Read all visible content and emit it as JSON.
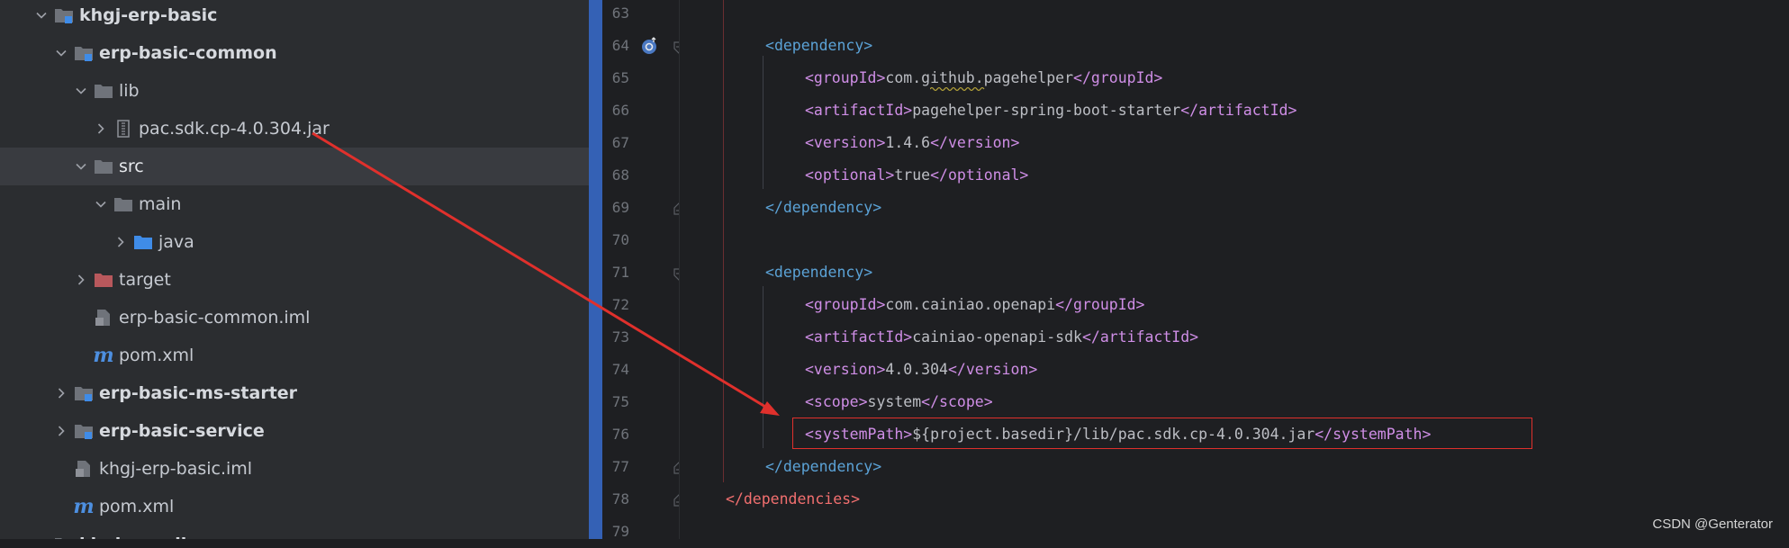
{
  "tree": {
    "items": [
      {
        "label": "khgj-erp-basic",
        "icon": "module-folder-icon",
        "bold": true
      },
      {
        "label": "erp-basic-common",
        "icon": "module-folder-icon",
        "bold": true
      },
      {
        "label": "lib",
        "icon": "folder-icon",
        "bold": false
      },
      {
        "label": "pac.sdk.cp-4.0.304.jar",
        "icon": "jar-icon",
        "bold": false
      },
      {
        "label": "src",
        "icon": "folder-icon",
        "bold": false
      },
      {
        "label": "main",
        "icon": "folder-icon",
        "bold": false
      },
      {
        "label": "java",
        "icon": "source-folder-icon",
        "bold": false
      },
      {
        "label": "target",
        "icon": "excluded-folder-icon",
        "bold": false
      },
      {
        "label": "erp-basic-common.iml",
        "icon": "iml-file-icon",
        "bold": false
      },
      {
        "label": "pom.xml",
        "icon": "maven-icon",
        "bold": false
      },
      {
        "label": "erp-basic-ms-starter",
        "icon": "module-folder-icon",
        "bold": true
      },
      {
        "label": "erp-basic-service",
        "icon": "module-folder-icon",
        "bold": true
      },
      {
        "label": "khgj-erp-basic.iml",
        "icon": "iml-file-icon",
        "bold": false
      },
      {
        "label": "pom.xml",
        "icon": "maven-icon",
        "bold": false
      },
      {
        "label": "khgj-supplier",
        "icon": "module-folder-icon",
        "bold": true
      }
    ],
    "selected": "src"
  },
  "editor": {
    "line_numbers": [
      "63",
      "64",
      "65",
      "66",
      "67",
      "68",
      "69",
      "70",
      "71",
      "72",
      "73",
      "74",
      "75",
      "76",
      "77",
      "78",
      "79"
    ],
    "lines": {
      "l64": {
        "open": "<",
        "tag": "dependency",
        "close": ">"
      },
      "l65": {
        "t1": "<groupId>",
        "v": "com.github.pagehelper",
        "t2": "</groupId>"
      },
      "l66": {
        "t1": "<artifactId>",
        "v": "pagehelper-spring-boot-starter",
        "t2": "</artifactId>"
      },
      "l67": {
        "t1": "<version>",
        "v": "1.4.6",
        "t2": "</version>"
      },
      "l68": {
        "t1": "<optional>",
        "v": "true",
        "t2": "</optional>"
      },
      "l69": {
        "text": "</dependency>"
      },
      "l71": {
        "text": "<dependency>"
      },
      "l72": {
        "t1": "<groupId>",
        "v": "com.cainiao.openapi",
        "t2": "</groupId>"
      },
      "l73": {
        "t1": "<artifactId>",
        "v": "cainiao-openapi-sdk",
        "t2": "</artifactId>"
      },
      "l74": {
        "t1": "<version>",
        "v": "4.0.304",
        "t2": "</version>"
      },
      "l75": {
        "t1": "<scope>",
        "v": "system",
        "t2": "</scope>"
      },
      "l76": {
        "t1": "<systemPath>",
        "v": "${project.basedir}/lib/pac.sdk.cp-4.0.304.jar",
        "t2": "</systemPath>"
      },
      "l77": {
        "text": "</dependency>"
      },
      "l78": {
        "text": "</dependencies>"
      }
    }
  },
  "colors": {
    "tag": "#5ba2d6",
    "child_tag": "#cf8ee6",
    "root_tag": "#f16f6f",
    "highlight_box": "#e0302c",
    "arrow": "#e0302c",
    "stripe": "#3461b5"
  },
  "watermark": "CSDN @Genterator"
}
